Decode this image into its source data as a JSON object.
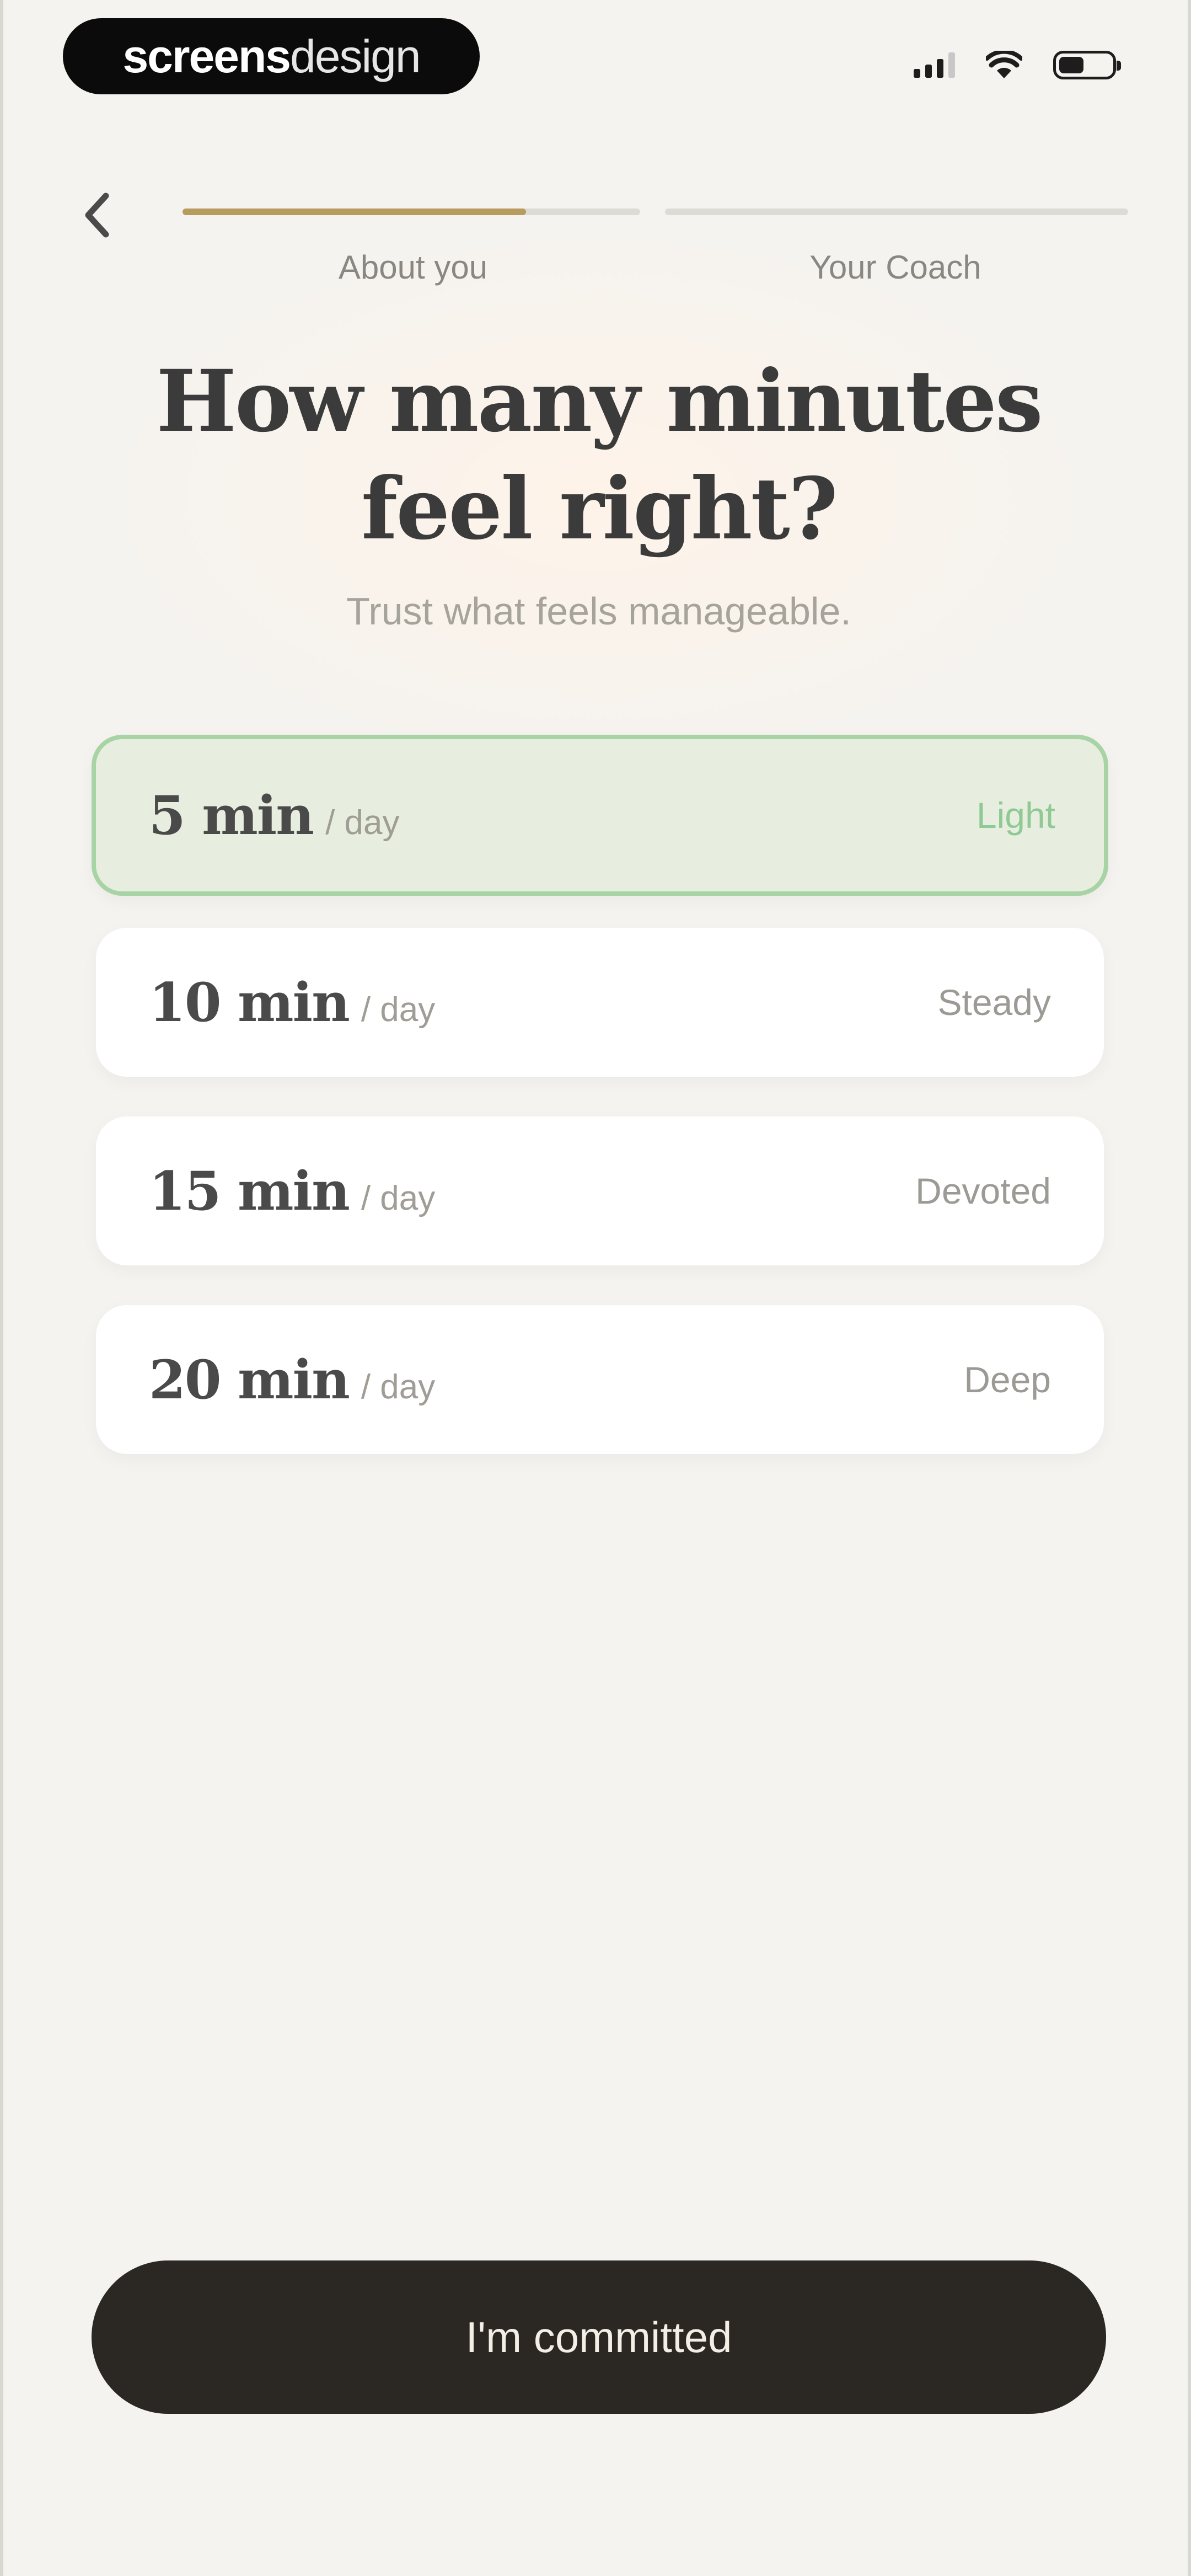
{
  "status_bar": {
    "brand_part1": "screens",
    "brand_part2": "design",
    "signal_icon": "cellular-signal-icon",
    "wifi_icon": "wifi-icon",
    "battery_icon": "battery-icon"
  },
  "nav": {
    "back_icon": "chevron-left-icon",
    "steps": [
      {
        "label": "About you",
        "progress": 0.75
      },
      {
        "label": "Your Coach",
        "progress": 0
      }
    ]
  },
  "header": {
    "title_line1": "How many minutes",
    "title_line2": "feel right?",
    "subtitle": "Trust what feels manageable."
  },
  "options": [
    {
      "value": "5 min",
      "unit": "/ day",
      "tag": "Light",
      "selected": true
    },
    {
      "value": "10 min",
      "unit": "/ day",
      "tag": "Steady",
      "selected": false
    },
    {
      "value": "15 min",
      "unit": "/ day",
      "tag": "Devoted",
      "selected": false
    },
    {
      "value": "20 min",
      "unit": "/ day",
      "tag": "Deep",
      "selected": false
    }
  ],
  "cta": {
    "label": "I'm committed"
  },
  "colors": {
    "accent_progress": "#b89b5e",
    "selected_border": "#a8d4a5",
    "selected_tag": "#8fca95",
    "cta_bg": "#2b2824"
  }
}
